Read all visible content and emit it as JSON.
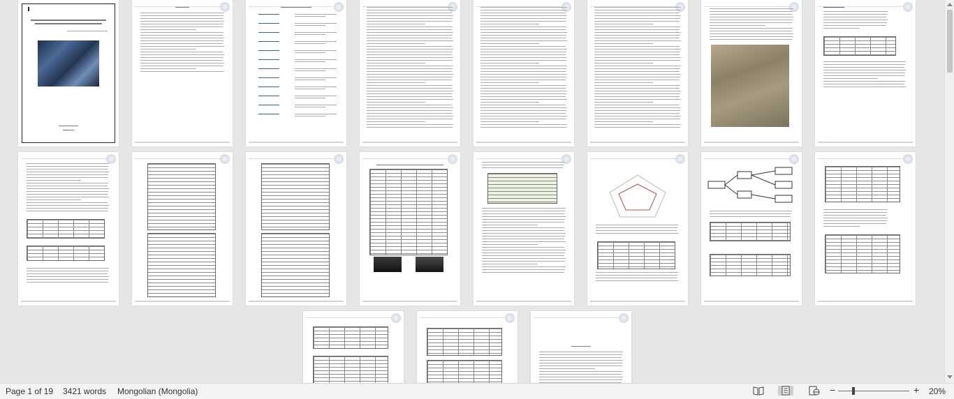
{
  "status": {
    "page": "Page 1 of 19",
    "words": "3421 words",
    "language": "Mongolian (Mongolia)",
    "zoom": "20%"
  },
  "view": {
    "read_mode_icon": "book-icon",
    "print_layout_icon": "page-icon",
    "web_layout_icon": "web-icon",
    "zoom_out": "−",
    "zoom_in": "+",
    "zoom_fraction": 0.2
  },
  "doc": {
    "page_count": 19
  }
}
